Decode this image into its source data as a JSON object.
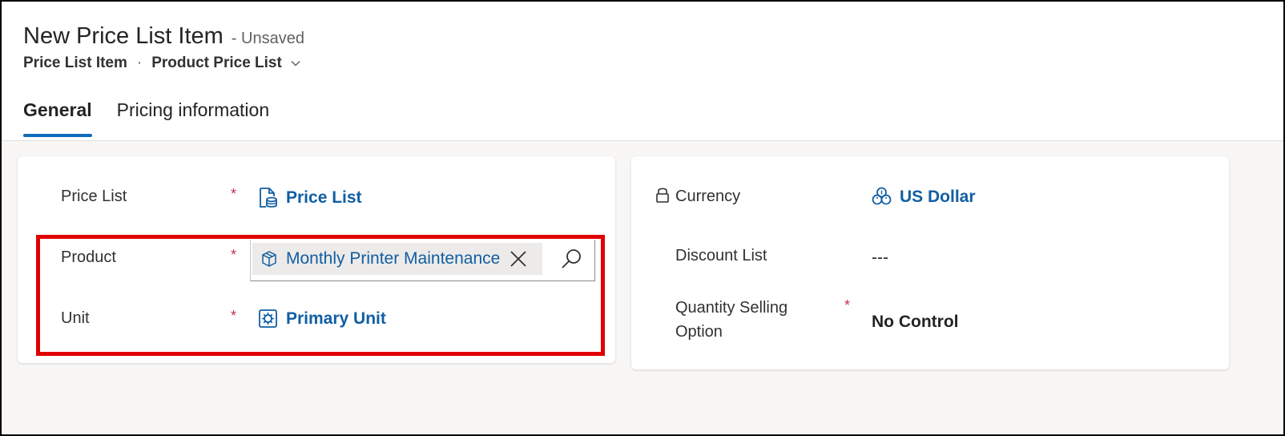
{
  "header": {
    "title": "New Price List Item",
    "status": "- Unsaved",
    "breadcrumb": {
      "entity": "Price List Item",
      "separator": "·",
      "form": "Product Price List"
    }
  },
  "tabs": [
    {
      "label": "General",
      "active": true
    },
    {
      "label": "Pricing information",
      "active": false
    }
  ],
  "left_card": {
    "price_list": {
      "label": "Price List",
      "required_mark": "*",
      "value": "Price List",
      "icon": "document-icon"
    },
    "product": {
      "label": "Product",
      "required_mark": "*",
      "value": "Monthly Printer Maintenance",
      "icon": "cube-icon"
    },
    "unit": {
      "label": "Unit",
      "required_mark": "*",
      "value": "Primary Unit",
      "icon": "unit-icon"
    }
  },
  "right_card": {
    "currency": {
      "label": "Currency",
      "value": "US Dollar",
      "icon": "currency-icon",
      "locked": true
    },
    "discount_list": {
      "label": "Discount List",
      "value": "---"
    },
    "quantity_selling_option": {
      "label_line1": "Quantity Selling",
      "label_line2": "Option",
      "required_mark": "*",
      "value": "No Control"
    }
  },
  "colors": {
    "accent": "#0f6cbd",
    "link": "#115ea3",
    "required": "#c4314b",
    "highlight": "#e00000"
  }
}
